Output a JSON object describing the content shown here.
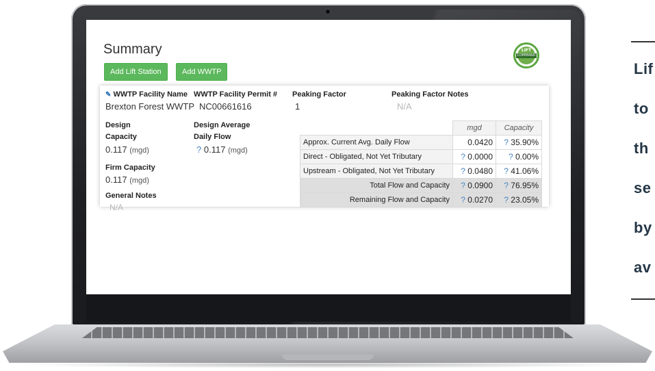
{
  "app": {
    "title": "Summary",
    "buttons": {
      "add_lift_station": "Add Lift Station",
      "add_wwtp": "Add WWTP"
    },
    "logo": {
      "top_text": "LIFT",
      "band_text": "COMMAND"
    }
  },
  "facility": {
    "name_label": "WWTP Facility Name",
    "name_value": "Brexton Forest WWTP",
    "permit_label": "WWTP Facility Permit #",
    "permit_value": "NC00661616",
    "peaking_factor_label": "Peaking Factor",
    "peaking_factor_value": "1",
    "peaking_notes_label": "Peaking Factor Notes",
    "peaking_notes_value": "N/A",
    "design_capacity_label_1": "Design",
    "design_capacity_label_2": "Capacity",
    "design_capacity_value": "0.117",
    "design_avg_label_1": "Design Average",
    "design_avg_label_2": "Daily Flow",
    "design_avg_value": "0.117",
    "unit": "(mgd)",
    "firm_capacity_label": "Firm Capacity",
    "firm_capacity_value": "0.117",
    "general_notes_label": "General Notes",
    "general_notes_value": "N/A",
    "help_mark": "?"
  },
  "flow_table": {
    "headers": {
      "mgd": "mgd",
      "capacity": "Capacity"
    },
    "rows": [
      {
        "label": "Approx. Current Avg. Daily Flow",
        "mgd": "0.0420",
        "capacity": "35.90%",
        "mgd_help": false,
        "cap_help": true
      },
      {
        "label": "Direct - Obligated, Not Yet Tributary",
        "mgd": "0.0000",
        "capacity": "0.00%",
        "mgd_help": true,
        "cap_help": true
      },
      {
        "label": "Upstream - Obligated, Not Yet Tributary",
        "mgd": "0.0480",
        "capacity": "41.06%",
        "mgd_help": true,
        "cap_help": true
      },
      {
        "label": "Total Flow and Capacity",
        "mgd": "0.0900",
        "capacity": "76.95%",
        "mgd_help": true,
        "cap_help": true
      },
      {
        "label": "Remaining Flow and Capacity",
        "mgd": "0.0270",
        "capacity": "23.05%",
        "mgd_help": true,
        "cap_help": true
      }
    ]
  },
  "side_text": {
    "lines": [
      "Lif",
      "to",
      "th",
      "se",
      "by",
      "av"
    ]
  }
}
